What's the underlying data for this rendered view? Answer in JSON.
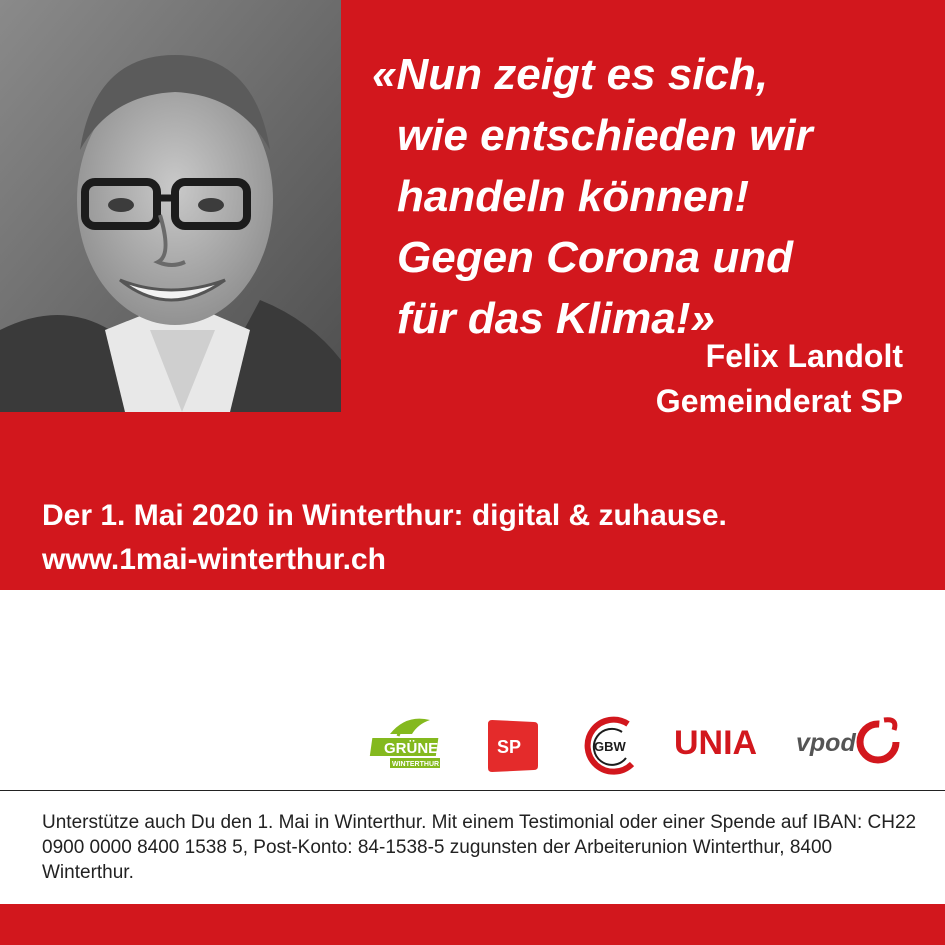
{
  "quote": {
    "lines": [
      "«Nun zeigt es sich,",
      "wie entschieden wir",
      "handeln können!",
      "Gegen Corona und",
      "für das Klima!»"
    ]
  },
  "author": {
    "name": "Felix Landolt",
    "role": "Gemeinderat SP"
  },
  "event": {
    "headline": "Der 1. Mai 2020 in Winterthur: digital & zuhause.",
    "url": "www.1mai-winterthur.ch"
  },
  "logos": {
    "gruene": "GRÜNE",
    "gruene_sub": "WINTERTHUR",
    "sp": "SP",
    "gbw": "GBW",
    "unia": "UNIA",
    "vpod": "vpod"
  },
  "footer": {
    "text": "Unterstütze auch Du den 1. Mai in Winterthur. Mit einem Testimonial oder einer Spende auf IBAN: CH22 0900 0000 8400 1538 5, Post-Konto: 84-1538-5 zugunsten der Arbeiterunion Winterthur, 8400 Winterthur."
  },
  "colors": {
    "brand_red": "#d2171d",
    "gruene_green": "#84b91e",
    "text_dark": "#222222"
  }
}
